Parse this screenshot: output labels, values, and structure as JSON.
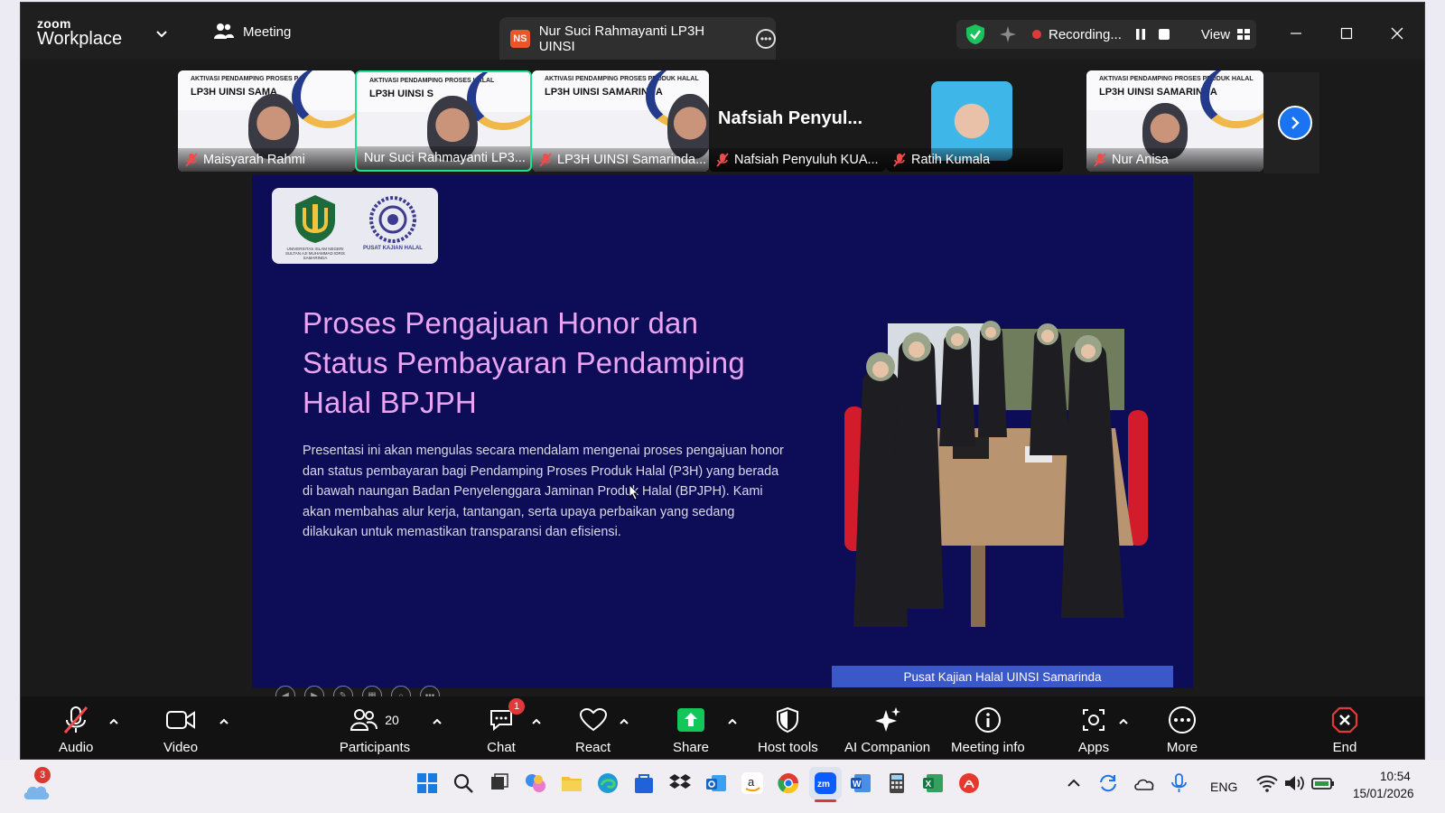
{
  "app": {
    "brand_top": "zoom",
    "brand_bottom": "Workplace",
    "meeting_tab": "Meeting",
    "active_tab_initials": "NS",
    "active_tab_title": "Nur Suci Rahmayanti LP3H UINSI",
    "recording_label": "Recording...",
    "view_label": "View"
  },
  "thumbnails": [
    {
      "name": "Maisyarah Rahmi",
      "banner_top": "AKTIVASI PENDAMPING PROSES P",
      "banner_title": "LP3H UINSI SAMA"
    },
    {
      "name": "Nur Suci Rahmayanti LP3...",
      "banner_top": "AKTIVASI PENDAMPING PROSES HALAL",
      "banner_title": "LP3H UINSI S"
    },
    {
      "name": "LP3H UINSI Samarinda...",
      "banner_top": "AKTIVASI PENDAMPING PROSES PRODUK HALAL",
      "banner_title": "LP3H UINSI SAMARINDA"
    },
    {
      "name": "Nafsiah Penyuluh KUA...",
      "big_name": "Nafsiah  Penyul..."
    },
    {
      "name": "Ratih Kumala"
    },
    {
      "name": "Nur Anisa",
      "banner_top": "AKTIVASI PENDAMPING PROSES PRODUK HALAL",
      "banner_title": "LP3H UINSI SAMARINDA"
    }
  ],
  "slide": {
    "title": "Proses Pengajuan Honor dan Status Pembayaran Pendamping Halal BPJPH",
    "body": "Presentasi ini akan mengulas secara mendalam mengenai proses pengajuan honor dan status pembayaran bagi Pendamping Proses Produk Halal (P3H) yang berada di bawah naungan Badan Penyelenggara Jaminan Produk Halal (BPJPH). Kami akan membahas alur kerja, tantangan, serta upaya perbaikan yang sedang dilakukan untuk memastikan transparansi dan efisiensi.",
    "caption": "Pusat Kajian Halal UINSI Samarinda",
    "logo_left_caption": "UNIVERSITAS ISLAM NEGERI SULTAN AJI MUHAMMAD IDRIS SAMARINDA",
    "logo_right_caption": "PUSAT KAJIAN HALAL"
  },
  "toolbar": {
    "audio": "Audio",
    "video": "Video",
    "participants": "Participants",
    "participants_count": "20",
    "chat": "Chat",
    "chat_badge": "1",
    "react": "React",
    "share": "Share",
    "host_tools": "Host tools",
    "ai_companion": "AI Companion",
    "meeting_info": "Meeting info",
    "apps": "Apps",
    "more": "More",
    "end": "End"
  },
  "taskbar": {
    "weather_badge": "3",
    "lang": "ENG",
    "time": "10:54",
    "date": "15/01/2026"
  },
  "colors": {
    "slide_bg": "#0d0c57",
    "title_pink": "#e9a3f1",
    "active_speaker": "#1fe28f",
    "share_green": "#12c65a",
    "end_red": "#e0393a"
  }
}
